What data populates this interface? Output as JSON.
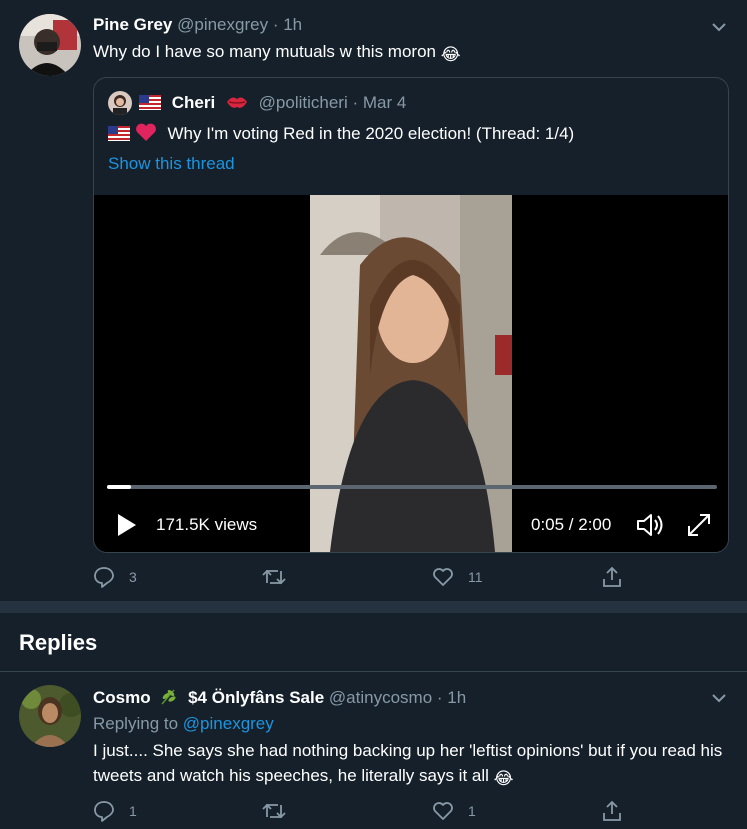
{
  "main_tweet": {
    "display_name": "Pine Grey",
    "handle": "@pinexgrey",
    "separator": "·",
    "time": "1h",
    "text": "Why do I have so many mutuals w this moron",
    "emoji": "😂",
    "quoted": {
      "display_name": "Cheri",
      "handle": "@politicheri",
      "date": "Mar 4",
      "text": "Why I'm voting Red in the 2020 election! (Thread: 1/4)",
      "show_thread": "Show this thread",
      "video": {
        "views": "171.5K views",
        "time": "0:05 / 2:00",
        "progress": 0.04
      }
    },
    "actions": {
      "replies": "3",
      "retweets": "",
      "likes": "11"
    }
  },
  "replies_header": "Replies",
  "reply": {
    "display_name": "Cosmo",
    "display_name_suffix": "$4 Önlyfâns Sale",
    "handle": "@atinycosmo",
    "separator": "·",
    "time": "1h",
    "replying_to_label": "Replying to",
    "replying_to_handle": "@pinexgrey",
    "text": "I just.... She says she had nothing backing up her 'leftist opinions' but if you read his tweets and watch his speeches, he literally says it all",
    "emoji": "😂",
    "actions": {
      "replies": "1",
      "retweets": "",
      "likes": "1"
    }
  },
  "colors": {
    "background": "#15202b",
    "muted": "#8899a6",
    "link": "#1b95e0",
    "border": "#38444d"
  }
}
